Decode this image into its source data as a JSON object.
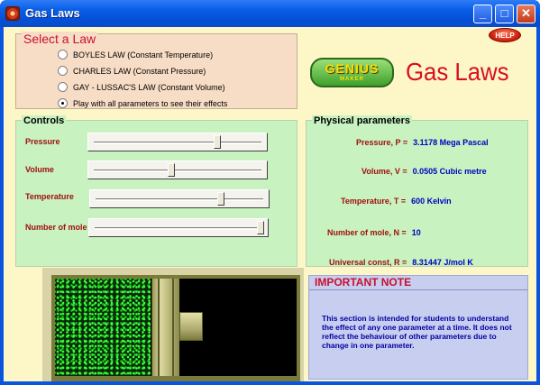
{
  "window": {
    "title": "Gas Laws",
    "buttons": {
      "minimize": "_",
      "maximize": "□",
      "close": "✕"
    }
  },
  "select_law": {
    "heading": "Select a Law",
    "options": [
      {
        "label": "BOYLES LAW   (Constant Temperature)",
        "selected": false
      },
      {
        "label": "CHARLES LAW  (Constant Pressure)",
        "selected": false
      },
      {
        "label": "GAY - LUSSAC'S LAW   (Constant Volume)",
        "selected": false
      },
      {
        "label": "Play with all parameters to see their effects",
        "selected": true
      }
    ]
  },
  "help_button": "HELP",
  "logo": {
    "main": "GENIUS",
    "sub": "MAKER"
  },
  "app_title": "Gas Laws",
  "controls": {
    "heading": "Controls",
    "sliders": [
      {
        "label": "Pressure",
        "level": 0.74
      },
      {
        "label": "Volume",
        "level": 0.46
      },
      {
        "label": "Temperature",
        "level": 0.75
      },
      {
        "label": "Number of mole",
        "level": 1.0
      }
    ]
  },
  "physical": {
    "heading": "Physical parameters",
    "rows": [
      {
        "label": "Pressure, P =",
        "value": "3.1178  Mega Pascal"
      },
      {
        "label": "Volume, V =",
        "value": "0.0505  Cubic metre"
      },
      {
        "label": "Temperature, T =",
        "value": "600  Kelvin"
      },
      {
        "label": "Number of mole, N =",
        "value": "10"
      }
    ]
  },
  "universal_const": {
    "label": "Universal const, R =",
    "value": "8.31447  J/mol K"
  },
  "note": {
    "title": "IMPORTANT NOTE",
    "text": "This section is intended for students to understand the effect of any one parameter at a time. It does not reflect the behaviour of other parameters due to change in one parameter."
  },
  "colors": {
    "law_panel": "#f7ddc5",
    "controls_panel": "#c8f2c0",
    "note_panel": "#c8cef0",
    "background": "#fdf7c8",
    "accent_red": "#c8102e",
    "value_blue": "#0000c0",
    "gas_particles": "#3aff3a"
  }
}
